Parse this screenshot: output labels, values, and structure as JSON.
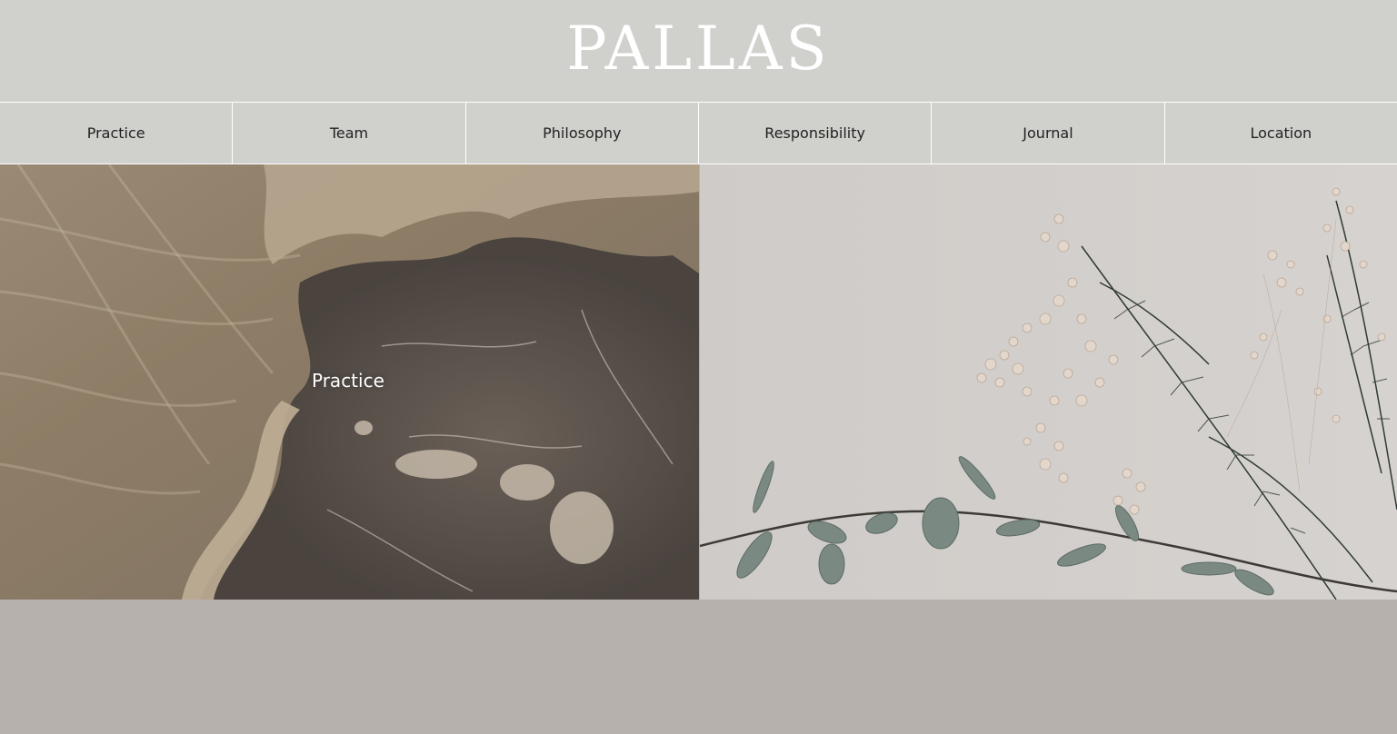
{
  "header": {
    "logo": "PALLAS"
  },
  "nav": {
    "items": [
      {
        "label": "Practice"
      },
      {
        "label": "Team"
      },
      {
        "label": "Philosophy"
      },
      {
        "label": "Responsibility"
      },
      {
        "label": "Journal"
      },
      {
        "label": "Location"
      }
    ]
  },
  "panels": {
    "left": {
      "label": "Practice",
      "image": "marble-texture-image"
    },
    "right": {
      "image": "dried-flowers-image"
    }
  },
  "colors": {
    "header_bg": "#d0d0cc",
    "page_bg": "#b7b1ad",
    "divider": "#ffffff"
  }
}
